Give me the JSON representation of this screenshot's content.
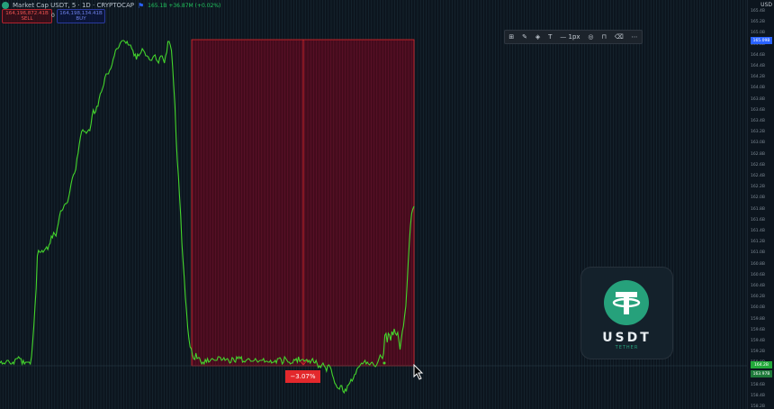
{
  "header": {
    "symbol_title": "Market Cap USDT, 5 · 1D · CRYPTOCAP",
    "stats": "165.1B +36.87M (+0.02%)",
    "sell_value": "164,196,872.41B",
    "sell_label": "SELL",
    "buy_value": "164,198,134.41B",
    "buy_label": "BUY",
    "separator": "0"
  },
  "toolbar": {
    "icons": [
      "grid-icon",
      "pencil-icon",
      "fill-icon",
      "text-icon",
      "line-icon",
      "circle-icon",
      "lock-icon",
      "trash-icon",
      "more-icon"
    ],
    "line_width_label": "1px",
    "text_label": "T"
  },
  "measure": {
    "percent_label": "−3.07%",
    "direction": "down"
  },
  "axis": {
    "currency": "USD",
    "ticks": [
      "165.4B",
      "165.2B",
      "165.0B",
      "164.8B",
      "164.6B",
      "164.4B",
      "164.2B",
      "164.0B",
      "163.8B",
      "163.6B",
      "163.4B",
      "163.2B",
      "163.0B",
      "162.8B",
      "162.6B",
      "162.4B",
      "162.2B",
      "162.0B",
      "161.8B",
      "161.6B",
      "161.4B",
      "161.2B",
      "161.0B",
      "160.8B",
      "160.6B",
      "160.4B",
      "160.2B",
      "160.0B",
      "159.8B",
      "159.6B",
      "159.4B",
      "159.2B",
      "159.0B",
      "158.8B",
      "158.6B",
      "158.4B",
      "158.2B"
    ],
    "price_tag_high": "165.09B",
    "price_tag_current": "164.2B",
    "price_tag_current_2": "163.97B"
  },
  "logo": {
    "name": "USDT",
    "subtitle": "TETHER"
  },
  "colors": {
    "line": "#44d62c",
    "measure_fill": "#5a0e22",
    "measure_border": "#e3282c",
    "tether": "#26a17b",
    "background": "#0c151e",
    "grid": "#1a2c36"
  },
  "chart_data": {
    "type": "line",
    "series": [
      {
        "values": [
          229,
          232,
          237,
          250,
          270,
          292,
          318,
          340,
          350,
          362,
          368,
          378,
          388,
          378,
          369,
          372,
          370,
          365,
          372,
          368,
          378,
          372,
          370,
          380,
          370,
          372,
          392,
          398,
          396,
          394,
          398,
          402,
          405,
          407,
          406,
          404,
          402,
          403,
          405,
          404,
          402,
          404,
          400,
          402,
          404,
          403,
          405,
          407,
          408,
          410,
          415,
          416,
          420,
          423,
          421,
          425,
          427,
          428,
          434,
          432,
          436,
          434,
          428,
          428,
          432,
          431,
          430,
          427,
          425,
          420,
          416,
          410,
          407,
          405,
          406,
          412,
          408,
          406,
          403,
          405,
          408,
          406,
          408,
          404,
          400,
          403,
          402,
          398,
          400,
          403,
          400,
          402,
          399,
          400,
          401,
          399,
          399,
          400,
          401,
          396,
          402,
          398,
          400,
          399,
          403,
          403,
          404,
          402,
          402,
          400,
          398,
          396,
          402,
          404,
          399,
          397,
          398,
          398,
          403,
          400,
          402,
          402,
          403,
          400,
          402,
          402,
          401,
          401,
          402,
          398,
          400,
          400,
          400,
          401,
          402,
          400,
          398,
          400,
          401,
          401,
          401,
          399,
          398,
          399,
          400,
          402,
          401,
          402,
          396,
          398,
          396,
          398,
          396,
          402,
          401,
          398,
          397,
          402,
          403,
          400,
          398,
          399,
          400,
          397,
          399,
          400,
          397,
          396,
          396,
          400,
          400,
          400,
          399,
          398,
          399,
          401,
          402,
          398,
          402,
          399,
          404,
          402,
          404,
          401,
          397,
          397,
          398,
          392,
          399,
          398,
          394,
          387,
          385,
          376,
          364,
          346,
          330,
          308,
          290,
          270,
          240,
          218,
          196,
          178,
          152,
          118,
          96,
          74,
          56,
          50,
          46,
          46,
          58,
          62,
          70,
          66,
          62,
          62,
          64,
          70,
          68,
          66,
          61,
          62,
          64,
          67,
          67,
          66,
          63,
          62,
          62,
          58,
          56,
          54,
          58,
          60,
          62,
          60,
          66,
          60,
          62,
          56,
          54,
          50,
          50,
          50,
          46,
          48,
          46,
          45,
          45,
          46,
          48,
          52,
          54,
          54,
          56,
          62,
          66,
          72,
          76,
          78,
          82,
          82,
          82,
          86,
          94,
          98,
          102,
          104,
          110,
          118,
          118,
          124,
          126,
          122,
          128,
          138,
          145,
          144,
          146,
          148,
          146,
          146,
          144,
          146,
          152,
          160,
          170,
          176,
          188,
          192,
          194,
          198,
          204,
          212,
          218,
          224,
          226,
          226,
          228,
          232,
          234,
          234,
          240,
          248,
          254,
          262,
          260,
          258,
          264,
          262,
          270,
          272,
          277,
          274,
          276,
          278,
          280,
          278,
          280,
          280,
          278,
          284,
          320,
          340,
          362,
          380,
          396,
          404,
          402,
          402,
          402,
          402,
          404,
          400,
          404,
          398,
          398,
          396,
          398,
          398,
          399,
          404,
          402,
          404,
          404,
          402,
          400,
          400,
          402,
          404,
          403,
          404,
          401,
          403
        ]
      }
    ],
    "xlabel": "",
    "ylabel": ""
  }
}
